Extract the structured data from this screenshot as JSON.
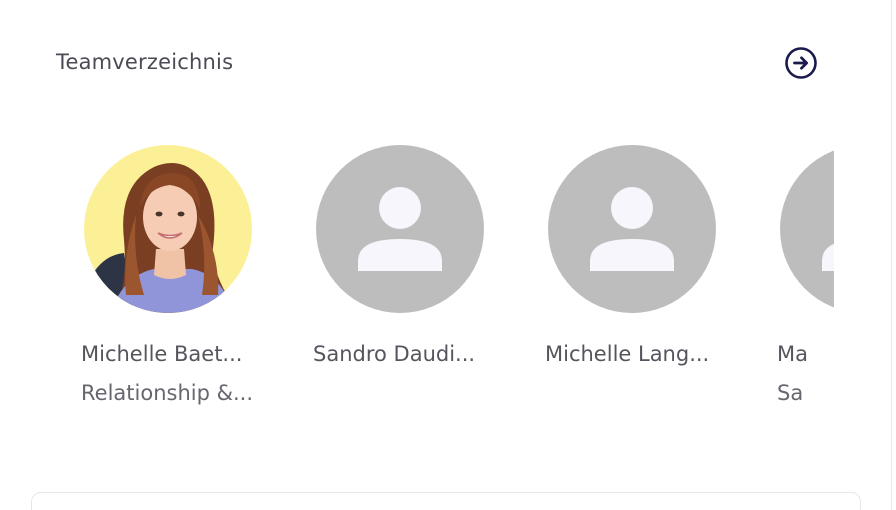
{
  "section": {
    "title": "Teamverzeichnis",
    "nav_icon": "arrow-right-circle-icon",
    "accent_color": "#1a1a4e"
  },
  "members": [
    {
      "name": "Michelle Baet...",
      "role": "Relationship &...",
      "avatar": "photo"
    },
    {
      "name": "Sandro Daudi...",
      "role": "",
      "avatar": "placeholder-person-icon"
    },
    {
      "name": "Michelle Lang...",
      "role": "",
      "avatar": "placeholder-person-icon"
    },
    {
      "name": "Ma",
      "role": "Sa",
      "avatar": "placeholder-person-icon"
    }
  ],
  "colors": {
    "placeholder_bg": "#bdbdbd",
    "placeholder_fg": "#f7f6fd",
    "photo_bg": "#fbf096"
  }
}
